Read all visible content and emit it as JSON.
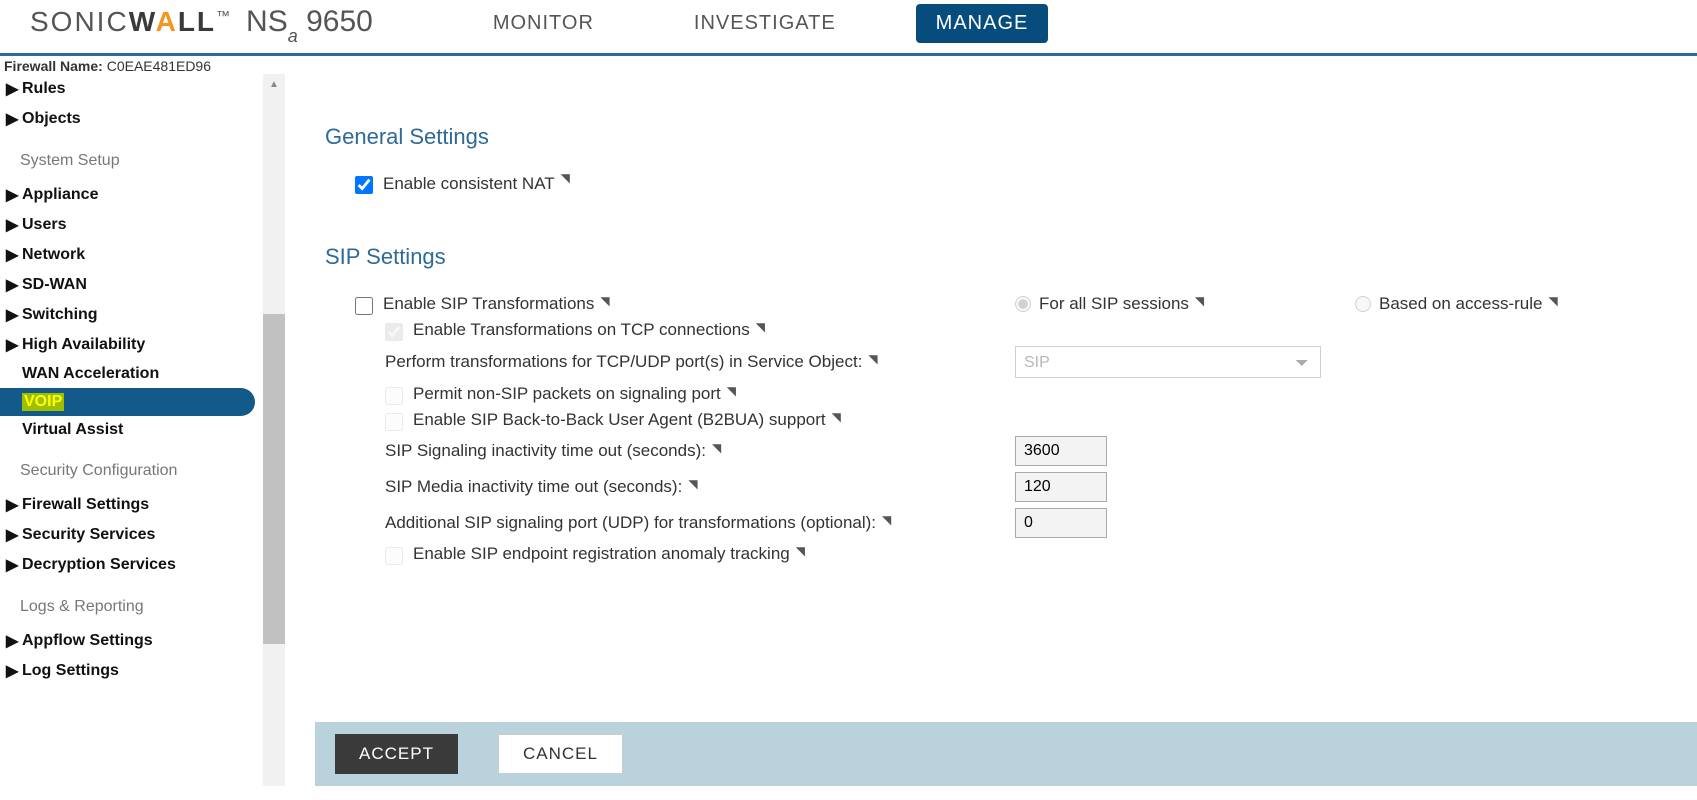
{
  "brand": {
    "logo": "SONICWALL",
    "model_prefix": "NS",
    "model_sub": "a",
    "model_num": "9650"
  },
  "tabs": {
    "monitor": "MONITOR",
    "investigate": "INVESTIGATE",
    "manage": "MANAGE"
  },
  "firewall": {
    "label": "Firewall Name:",
    "value": "C0EAE481ED96"
  },
  "sidebar": {
    "rules": "Rules",
    "objects": "Objects",
    "grp_system": "System Setup",
    "appliance": "Appliance",
    "users": "Users",
    "network": "Network",
    "sdwan": "SD-WAN",
    "switching": "Switching",
    "ha": "High Availability",
    "wan_accel": "WAN Acceleration",
    "voip": "VOIP",
    "virtual_assist": "Virtual Assist",
    "grp_security": "Security Configuration",
    "fw_settings": "Firewall Settings",
    "sec_services": "Security Services",
    "decrypt": "Decryption Services",
    "grp_logs": "Logs & Reporting",
    "appflow": "Appflow Settings",
    "log_settings": "Log Settings"
  },
  "sections": {
    "general": "General Settings",
    "sip": "SIP Settings"
  },
  "fields": {
    "consistent_nat": "Enable consistent NAT",
    "sip_transformations": "Enable SIP Transformations",
    "for_all_sip": "For all SIP sessions",
    "based_on_rule": "Based on access-rule",
    "tcp_transformations": "Enable Transformations on TCP connections",
    "perform_transformations": "Perform transformations for TCP/UDP port(s) in Service Object:",
    "service_object": "SIP",
    "permit_nonsip": "Permit non-SIP packets on signaling port",
    "b2bua": "Enable SIP Back-to-Back User Agent (B2BUA) support",
    "sip_signaling": "SIP Signaling inactivity time out (seconds):",
    "sip_signaling_val": "3600",
    "sip_media": "SIP Media inactivity time out (seconds):",
    "sip_media_val": "120",
    "additional_port": "Additional SIP signaling port (UDP) for transformations (optional):",
    "additional_port_val": "0",
    "anomaly": "Enable SIP endpoint registration anomaly tracking"
  },
  "actions": {
    "accept": "ACCEPT",
    "cancel": "CANCEL"
  },
  "help_glyph": "◥"
}
